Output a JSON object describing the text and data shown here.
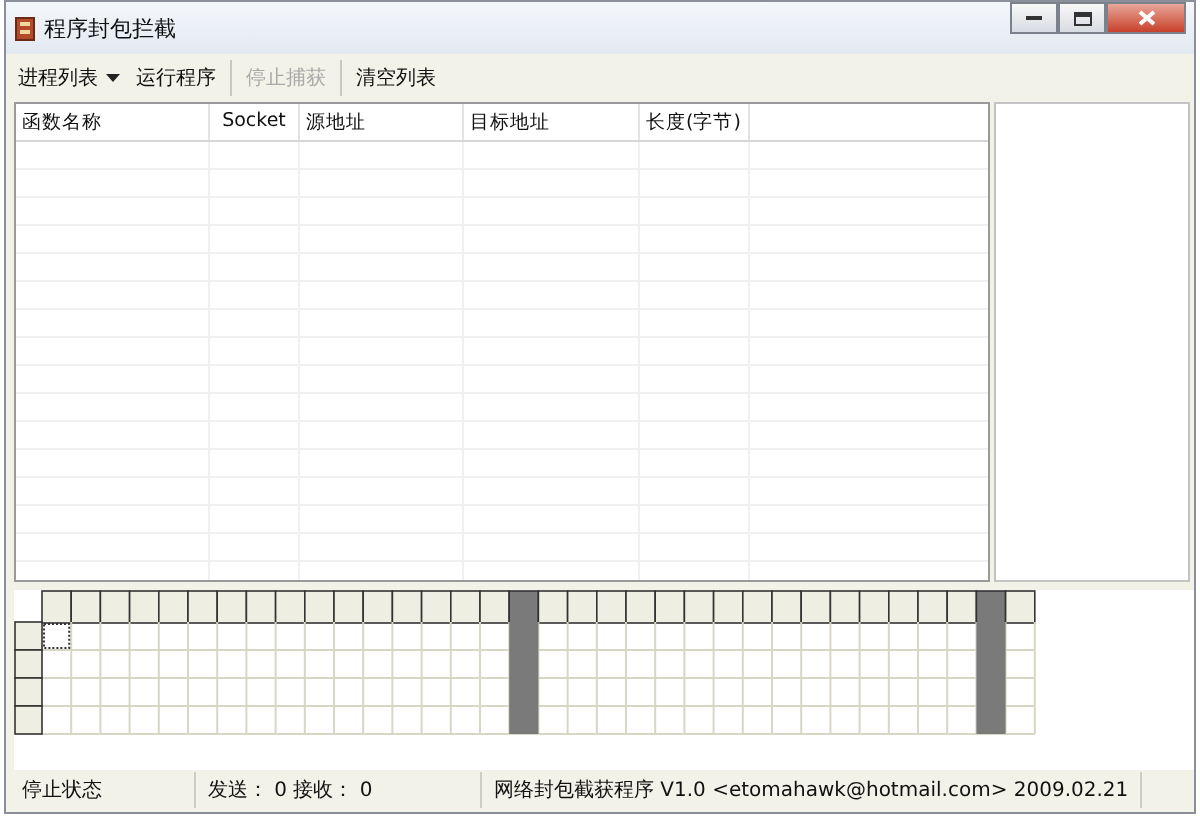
{
  "window": {
    "title": "程序封包拦截"
  },
  "toolbar": [
    {
      "label": "进程列表",
      "kind": "dropdown",
      "disabled": false
    },
    {
      "label": "运行程序",
      "kind": "button",
      "disabled": false
    },
    {
      "label": "停止捕获",
      "kind": "button",
      "disabled": true
    },
    {
      "label": "清空列表",
      "kind": "button",
      "disabled": false
    }
  ],
  "table": {
    "columns": [
      "函数名称",
      "Socket",
      "源地址",
      "目标地址",
      "长度(字节)"
    ]
  },
  "status_bar": [
    "停止状态",
    "发送： 0  接收： 0",
    "网络封包截获程序 V1.0  <etomahawk@hotmail.com>  2009.02.21"
  ]
}
